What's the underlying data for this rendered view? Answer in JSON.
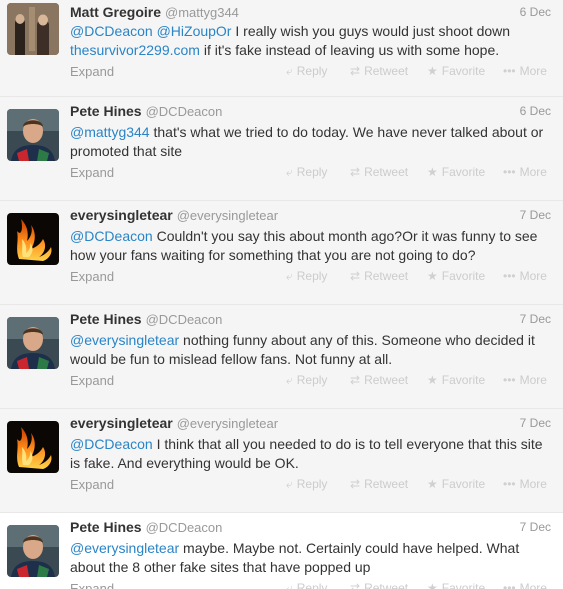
{
  "tweets": [
    {
      "name": "Matt Gregoire",
      "handle": "@mattyg344",
      "date": "6 Dec",
      "avatar": "photo-couple",
      "parts": [
        {
          "t": "@DCDeacon",
          "k": "mention"
        },
        {
          "t": " ",
          "k": "plain"
        },
        {
          "t": "@HiZoupOr",
          "k": "mention"
        },
        {
          "t": " I really wish you guys would just shoot down ",
          "k": "plain"
        },
        {
          "t": "thesurvivor2299.com",
          "k": "link"
        },
        {
          "t": " if it's fake instead of leaving us with some hope.",
          "k": "plain"
        }
      ]
    },
    {
      "name": "Pete Hines",
      "handle": "@DCDeacon",
      "date": "6 Dec",
      "avatar": "photo-man-jersey",
      "parts": [
        {
          "t": "@mattyg344",
          "k": "mention"
        },
        {
          "t": " that's what we tried to do today. We have never talked about or promoted that site",
          "k": "plain"
        }
      ]
    },
    {
      "name": "everysingletear",
      "handle": "@everysingletear",
      "date": "7 Dec",
      "avatar": "flame-logo",
      "parts": [
        {
          "t": "@DCDeacon",
          "k": "mention"
        },
        {
          "t": " Couldn't you say this about month ago?Or it was funny to see how your fans waiting for something that you are not going to do?",
          "k": "plain"
        }
      ]
    },
    {
      "name": "Pete Hines",
      "handle": "@DCDeacon",
      "date": "7 Dec",
      "avatar": "photo-man-jersey",
      "parts": [
        {
          "t": "@everysingletear",
          "k": "mention"
        },
        {
          "t": " nothing funny about any of this. Someone who decided it would be fun to mislead fellow fans. Not funny at all.",
          "k": "plain"
        }
      ]
    },
    {
      "name": "everysingletear",
      "handle": "@everysingletear",
      "date": "7 Dec",
      "avatar": "flame-logo",
      "parts": [
        {
          "t": "@DCDeacon",
          "k": "mention"
        },
        {
          "t": " I think that all you needed to do is to tell everyone that this site is fake. And everything would be OK.",
          "k": "plain"
        }
      ]
    },
    {
      "name": "Pete Hines",
      "handle": "@DCDeacon",
      "date": "7 Dec",
      "avatar": "photo-man-jersey",
      "parts": [
        {
          "t": "@everysingletear",
          "k": "mention"
        },
        {
          "t": " maybe. Maybe not. Certainly could have helped. What about the 8 other fake sites that have popped up",
          "k": "plain"
        }
      ]
    }
  ],
  "actions": {
    "expand": "Expand",
    "reply": "Reply",
    "retweet": "Retweet",
    "favorite": "Favorite",
    "more": "More",
    "reply_icon": "reply-arrow-icon",
    "retweet_icon": "retweet-icon",
    "favorite_icon": "star-icon",
    "more_icon": "dots-icon"
  },
  "colors": {
    "link": "#2a84c6",
    "muted": "#999999",
    "action": "#cccccc"
  }
}
